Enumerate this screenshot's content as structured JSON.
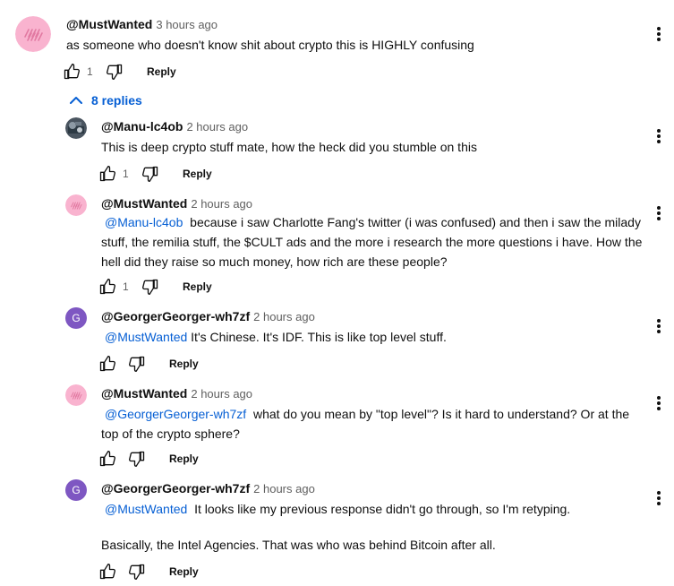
{
  "top_comment": {
    "author": "@MustWanted",
    "time": "3 hours ago",
    "text": "as someone who doesn't know shit about crypto this is HIGHLY confusing",
    "likes": "1",
    "reply_label": "Reply"
  },
  "replies_toggle": {
    "label": "8 replies"
  },
  "replies": [
    {
      "author": "@Manu-lc4ob",
      "time": "2 hours ago",
      "mention": "",
      "text": "This is deep crypto stuff mate, how the heck did you stumble on this",
      "likes": "1",
      "reply_label": "Reply"
    },
    {
      "author": "@MustWanted",
      "time": "2 hours ago",
      "mention": "@Manu-lc4ob",
      "text": "because i saw Charlotte Fang's twitter (i was confused) and then i saw the milady stuff, the remilia stuff, the $CULT ads and the more i research the more questions i have. How the hell did they raise so much money, how rich are these people?",
      "likes": "1",
      "reply_label": "Reply"
    },
    {
      "author": "@GeorgerGeorger-wh7zf",
      "time": "2 hours ago",
      "mention": "@MustWanted",
      "text": "It's Chinese. It's IDF. This is like top level stuff.",
      "likes": "",
      "reply_label": "Reply",
      "avatar_letter": "G"
    },
    {
      "author": "@MustWanted",
      "time": "2 hours ago",
      "mention": "@GeorgerGeorger-wh7zf",
      "text": "what do you mean by \"top level\"? Is it hard to understand? Or at the top of the crypto sphere?",
      "likes": "",
      "reply_label": "Reply"
    },
    {
      "author": "@GeorgerGeorger-wh7zf",
      "time": "2 hours ago",
      "mention": "@MustWanted",
      "text": "It looks like my previous response didn't go through, so I'm retyping.",
      "text2": "Basically, the Intel Agencies. That was who was behind Bitcoin after all.",
      "likes": "",
      "reply_label": "Reply",
      "avatar_letter": "G"
    }
  ],
  "colors": {
    "mention": "#065fd4",
    "pink_avatar": "#f9b3cf",
    "purple_avatar": "#7e57c2"
  }
}
